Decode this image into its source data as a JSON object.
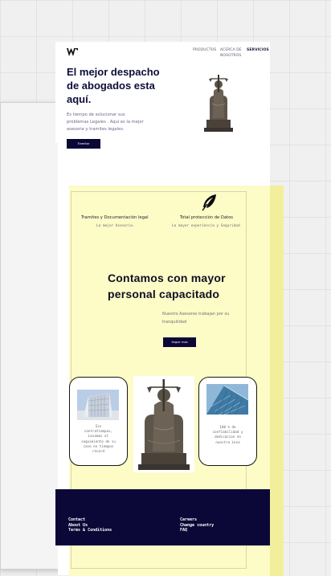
{
  "nav": {
    "items": [
      {
        "label": "PRODUCTOS",
        "active": false
      },
      {
        "label": "ACERCA DE",
        "active": false
      },
      {
        "label": "NOSOTROS",
        "active": false
      },
      {
        "label": "SERVICIOS",
        "active": true
      }
    ]
  },
  "hero": {
    "title_line1": "El mejor despacho",
    "title_line2": "de abogados esta",
    "title_line3": "aquí.",
    "sub_line1": "Es tiempo de solucionar sus",
    "sub_line2": "problemas Legales . Aqui es la mejor",
    "sub_line3": "asesoria y tramites legales.",
    "button_label": "Tramitar"
  },
  "features": [
    {
      "title": "Tramites y Documentación legal",
      "subtitle": "La mejor Asesoria."
    },
    {
      "title": "Total protección de Datos",
      "subtitle": "La mayor experiencia y Seguridad"
    }
  ],
  "mid": {
    "title_line1": "Contamos con mayor",
    "title_line2": "personal capacitado",
    "sub_line1": "Nuestro Asesores trabajan por su",
    "sub_line2": "tranquilidad",
    "button_label": "Seguir mas"
  },
  "cards": [
    {
      "lines": [
        "Sin",
        "contratiempos,",
        "Levamos el",
        "seguimiento de su",
        "caso en tiempos",
        "record"
      ]
    },
    {
      "lines": [
        "100 % de",
        "confiabilidad y",
        "dedicacion en",
        "nuestra Lesa"
      ]
    }
  ],
  "footer": {
    "left": [
      "Contact",
      "About Us",
      "Terms & Conditions"
    ],
    "right": [
      "Careers",
      "Change country",
      "FAQ"
    ]
  },
  "colors": {
    "navy": "#0b0838",
    "yellow": "#fdfbc6",
    "canvas": "#f0f0f0"
  }
}
